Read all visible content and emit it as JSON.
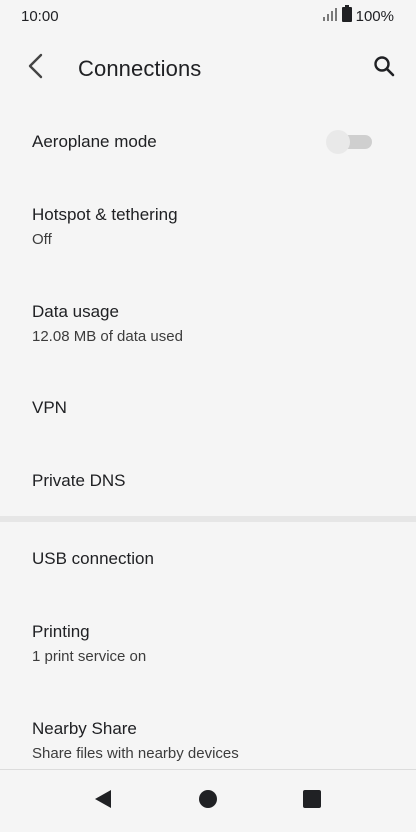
{
  "status_bar": {
    "time": "10:00",
    "battery_text": "100%",
    "icons": [
      "signal-icon",
      "battery-icon"
    ]
  },
  "app_bar": {
    "title": "Connections",
    "back_icon": "chevron-left-icon",
    "search_icon": "search-icon"
  },
  "settings": {
    "aeroplane": {
      "title": "Aeroplane mode",
      "enabled": false
    },
    "hotspot": {
      "title": "Hotspot & tethering",
      "summary": "Off"
    },
    "data_usage": {
      "title": "Data usage",
      "summary": "12.08 MB of data used"
    },
    "vpn": {
      "title": "VPN"
    },
    "private_dns": {
      "title": "Private DNS"
    },
    "usb": {
      "title": "USB connection"
    },
    "printing": {
      "title": "Printing",
      "summary": "1 print service on"
    },
    "nearby_share": {
      "title": "Nearby Share",
      "summary": "Share files with nearby devices"
    }
  },
  "nav_bar": {
    "icons": [
      "back-triangle-icon",
      "home-circle-icon",
      "recents-square-icon"
    ]
  },
  "colors": {
    "background": "#f5f5f5",
    "text_primary": "#202124",
    "toggle_off_track": "#cfcfcf",
    "toggle_off_thumb": "#e9e9e9",
    "divider": "#e6e6e6"
  }
}
